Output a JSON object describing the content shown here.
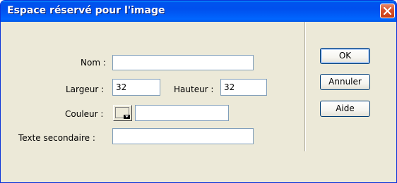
{
  "window": {
    "title": "Espace réservé pour l'image"
  },
  "form": {
    "name_label": "Nom :",
    "name_value": "",
    "width_label": "Largeur :",
    "width_value": "32",
    "height_label": "Hauteur :",
    "height_value": "32",
    "color_label": "Couleur :",
    "color_value": "",
    "alt_label": "Texte secondaire :",
    "alt_value": ""
  },
  "buttons": {
    "ok": "OK",
    "cancel": "Annuler",
    "help": "Aide"
  },
  "colors": {
    "titlebar": "#0053ee",
    "dialog_bg": "#ece9d8",
    "close_button": "#d8502a"
  },
  "icons": {
    "close": "close-icon",
    "dropdown": "chevron-down-icon"
  }
}
